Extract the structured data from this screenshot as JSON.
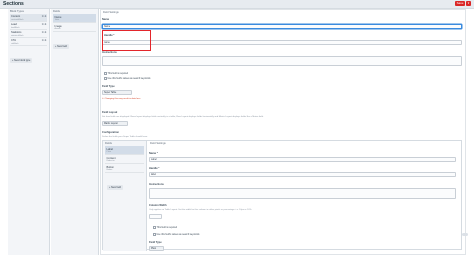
{
  "header": {
    "title": "Sections",
    "save_label": "Save",
    "save_caret": "▾"
  },
  "block_types": {
    "heading": "Block Types",
    "items": [
      {
        "name": "Content",
        "handle": "contentsBlock"
      },
      {
        "name": "Lead",
        "handle": "leadBlock"
      },
      {
        "name": "Statistics",
        "handle": "statisticsBlock"
      },
      {
        "name": "CTA",
        "handle": "ctaBlock"
      }
    ],
    "new_button": "+ New block type"
  },
  "fields": {
    "heading": "Fields",
    "items": [
      {
        "name": "Name",
        "type": "Table"
      },
      {
        "name": "Image",
        "type": "Assets"
      }
    ],
    "new_button": "+ New field"
  },
  "settings": {
    "heading": "Field Settings",
    "name_label": "Name",
    "name_value": "Name",
    "handle_label": "Handle *",
    "handle_value": "name",
    "instructions_label": "Instructions",
    "required_label": "This field is required",
    "searchable_label": "Use this field's values as search keywords",
    "field_type_label": "Field Type",
    "field_type_value": "Super Table",
    "field_type_warning": "⚠ Changing this may result in data loss.",
    "layout_label": "Field Layout",
    "layout_hint": "Set how fields are displayed. Rows layout displays fields vertically in a table, Row Layout displays fields horizontally and Matrix Layout displays fields like a Matrix field.",
    "layout_value": "Matrix Layout",
    "config_label": "Configuration",
    "config_hint": "Define the fields your Super Table should have.",
    "sub": {
      "fields_heading": "Fields",
      "items": [
        {
          "name": "Label",
          "type": "Plain"
        },
        {
          "name": "Content",
          "type": "Redactor"
        },
        {
          "name": "Button",
          "type": "Button"
        }
      ],
      "new_button": "+ New field",
      "settings_heading": "Field Settings",
      "name_label": "Name *",
      "name_value": "Label",
      "handle_label": "Handle *",
      "handle_value": "label",
      "instructions_label": "Instructions",
      "width_label": "Column Width",
      "width_hint": "Only applies on Table Layout. Set the width for this column in either pixels or percentage. i.e. 10px or 10%.",
      "required_label": "This field is required",
      "searchable_label": "Use this field's values as search keywords",
      "field_type_label": "Field Type",
      "field_type_value": "Plain"
    }
  }
}
